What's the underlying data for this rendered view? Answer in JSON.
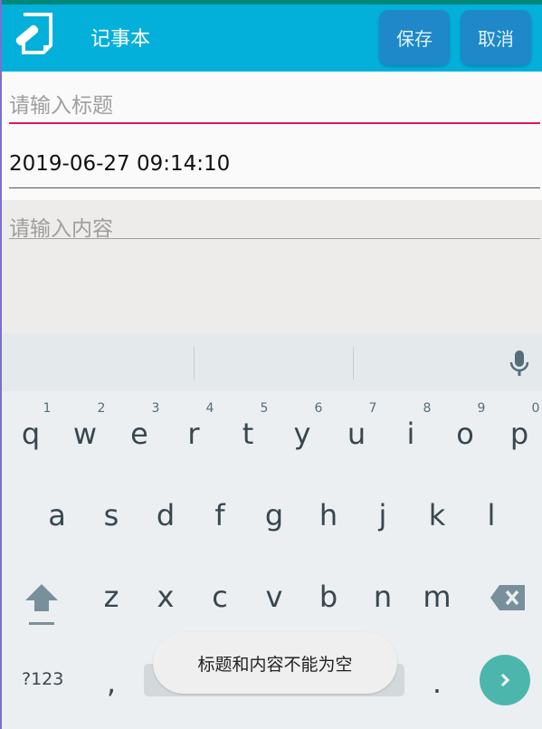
{
  "toolbar": {
    "title": "记事本",
    "save_label": "保存",
    "cancel_label": "取消",
    "app_icon": "notepad-pencil-icon",
    "color": "#03b0da"
  },
  "form": {
    "title_placeholder": "请输入标题",
    "date_value": "2019-06-27 09:14:10",
    "content_placeholder": "请输入内容"
  },
  "keyboard": {
    "row1": [
      {
        "k": "q",
        "d": "1"
      },
      {
        "k": "w",
        "d": "2"
      },
      {
        "k": "e",
        "d": "3"
      },
      {
        "k": "r",
        "d": "4"
      },
      {
        "k": "t",
        "d": "5"
      },
      {
        "k": "y",
        "d": "6"
      },
      {
        "k": "u",
        "d": "7"
      },
      {
        "k": "i",
        "d": "8"
      },
      {
        "k": "o",
        "d": "9"
      },
      {
        "k": "p",
        "d": "0"
      }
    ],
    "row2": [
      "a",
      "s",
      "d",
      "f",
      "g",
      "h",
      "j",
      "k",
      "l"
    ],
    "row3": [
      "z",
      "x",
      "c",
      "v",
      "b",
      "n",
      "m"
    ],
    "symbols_label": "?123",
    "comma": ",",
    "period": ".",
    "icons": [
      "microphone-icon",
      "shift-icon",
      "backspace-icon",
      "enter-arrow-icon"
    ]
  },
  "toast": {
    "message": "标题和内容不能为空"
  }
}
